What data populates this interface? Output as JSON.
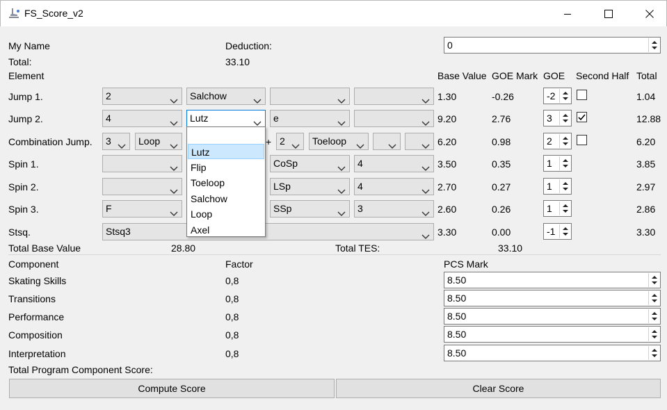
{
  "window": {
    "title": "FS_Score_v2",
    "icon": "skate-icon"
  },
  "header": {
    "name_label": "My Name",
    "deduction_label": "Deduction:",
    "deduction_value": "0",
    "total_label": "Total:",
    "total_value": "33.10"
  },
  "columns": {
    "element": "Element",
    "base_value": "Base Value",
    "goe_mark": "GOE Mark",
    "goe": "GOE",
    "second_half": "Second Half",
    "total": "Total"
  },
  "rows": [
    {
      "label": "Jump 1.",
      "c1": "2",
      "c2": "Salchow",
      "c3": "",
      "c4": "",
      "base": "1.30",
      "goe_mark": "-0.26",
      "goe": "-2",
      "second_half": false,
      "total": "1.04"
    },
    {
      "label": "Jump 2.",
      "c1": "4",
      "c2": "Lutz",
      "c3": "e",
      "c4": "",
      "base": "9.20",
      "goe_mark": "2.76",
      "goe": "3",
      "second_half": true,
      "total": "12.88"
    },
    {
      "label": "Combination Jump.",
      "c1": "3",
      "c2": "Loop",
      "plus": "+",
      "c5": "2",
      "c6": "Toeloop",
      "c7": "",
      "c8": "",
      "base": "6.20",
      "goe_mark": "0.98",
      "goe": "2",
      "second_half": false,
      "total": "6.20"
    },
    {
      "label": "Spin 1.",
      "c1": "",
      "c3": "CoSp",
      "c4": "4",
      "base": "3.50",
      "goe_mark": "0.35",
      "goe": "1",
      "total": "3.85"
    },
    {
      "label": "Spin 2.",
      "c1": "",
      "c3": "LSp",
      "c4": "4",
      "base": "2.70",
      "goe_mark": "0.27",
      "goe": "1",
      "total": "2.97"
    },
    {
      "label": "Spin 3.",
      "c1": "F",
      "c3": "SSp",
      "c4": "3",
      "base": "2.60",
      "goe_mark": "0.26",
      "goe": "1",
      "total": "2.86"
    },
    {
      "label": "Stsq.",
      "c1": "Stsq3",
      "base": "3.30",
      "goe_mark": "0.00",
      "goe": "-1",
      "total": "3.30"
    }
  ],
  "totals": {
    "tbv_label": "Total Base Value",
    "tbv_value": "28.80",
    "tes_label": "Total TES:",
    "tes_value": "33.10"
  },
  "components": {
    "header_component": "Component",
    "header_factor": "Factor",
    "header_pcs": "PCS Mark",
    "items": [
      {
        "name": "Skating Skills",
        "factor": "0,8",
        "mark": "8.50"
      },
      {
        "name": "Transitions",
        "factor": "0,8",
        "mark": "8.50"
      },
      {
        "name": "Performance",
        "factor": "0,8",
        "mark": "8.50"
      },
      {
        "name": "Composition",
        "factor": "0,8",
        "mark": "8.50"
      },
      {
        "name": "Interpretation",
        "factor": "0,8",
        "mark": "8.50"
      }
    ],
    "total_label": "Total Program Component Score:"
  },
  "buttons": {
    "compute": "Compute Score",
    "clear": "Clear Score"
  },
  "dropdown": {
    "options": [
      "",
      "Lutz",
      "Flip",
      "Toeloop",
      "Salchow",
      "Loop",
      "Axel"
    ],
    "selected": "Lutz"
  }
}
